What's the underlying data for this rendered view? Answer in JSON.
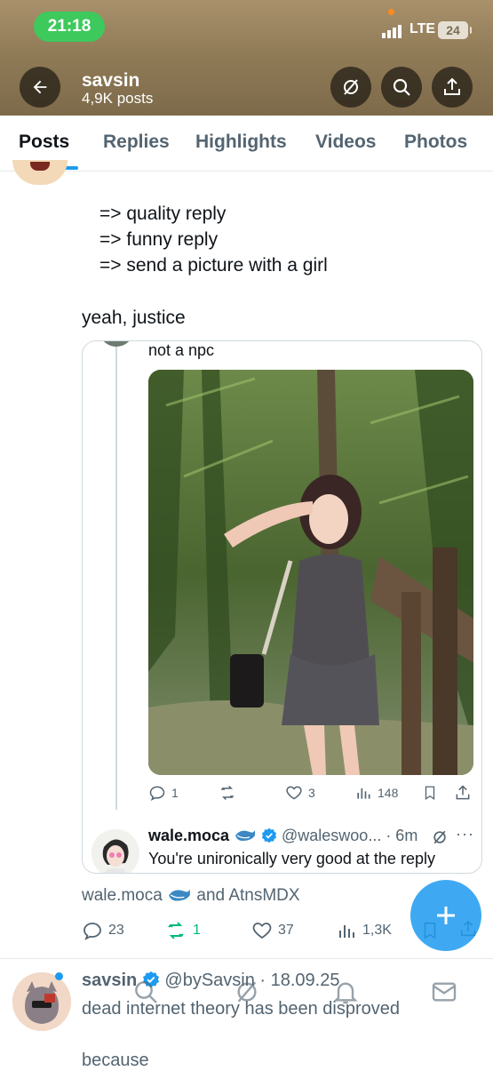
{
  "status": {
    "time": "21:18",
    "network": "LTE",
    "battery": "24"
  },
  "profile": {
    "name": "savsin",
    "posts": "4,9K posts"
  },
  "tabs": [
    "Posts",
    "Replies",
    "Highlights",
    "Videos",
    "Photos"
  ],
  "post": {
    "lines": [
      "=> quality reply",
      "=> funny reply",
      "=> send a picture with a girl"
    ],
    "closing": "yeah, justice"
  },
  "quote": {
    "text": "not a npc",
    "stats": {
      "replies": "1",
      "likes": "3",
      "views": "148"
    },
    "reply": {
      "name": "wale.moca",
      "handle": "@waleswoo... · 6m",
      "text": "You're unironically very good at the reply"
    }
  },
  "liked_by": {
    "first": "wale.moca",
    "joiner": "and",
    "second": "AtnsMDX"
  },
  "post_actions": {
    "replies": "23",
    "reposts": "1",
    "likes": "37",
    "views": "1,3K"
  },
  "next_post": {
    "name": "savsin",
    "handle": "@bySavsin · 18.09.25",
    "line1": "dead internet theory has been disproved",
    "line2": "because"
  },
  "colors": {
    "accent": "#1d9bf0",
    "repost_active": "#00ba7c",
    "status_pill": "#3ec95c"
  }
}
